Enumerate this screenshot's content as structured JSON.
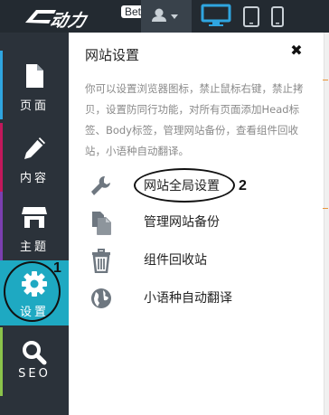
{
  "header": {
    "logo_text": "动力",
    "beta_badge": "Beta",
    "user_icon": "user-icon",
    "devices": [
      "desktop-icon",
      "tablet-icon",
      "phone-icon"
    ]
  },
  "sidebar": {
    "items": [
      {
        "label": "页面",
        "icon": "page-icon",
        "accent": "#2fa5e0"
      },
      {
        "label": "内容",
        "icon": "pencil-icon",
        "accent": "#c2185b"
      },
      {
        "label": "主题",
        "icon": "store-icon",
        "accent": "#7b3fb0"
      },
      {
        "label": "设置",
        "icon": "gear-icon",
        "accent": "#1ea9c2"
      },
      {
        "label": "SEO",
        "icon": "search-icon",
        "accent": "#8bc34a"
      }
    ]
  },
  "panel": {
    "title": "网站设置",
    "close_icon": "close-icon",
    "description": "你可以设置浏览器图标，禁止鼠标右键，禁止拷贝，设置防同行功能，对所有页面添加Head标签、Body标签，管理网站备份，查看组件回收站，小语种自动翻译。",
    "items": [
      {
        "label": "网站全局设置",
        "icon": "wrench-icon"
      },
      {
        "label": "管理网站备份",
        "icon": "backup-icon"
      },
      {
        "label": "组件回收站",
        "icon": "trash-icon"
      },
      {
        "label": "小语种自动翻译",
        "icon": "globe-icon"
      }
    ]
  },
  "annotations": {
    "marker_1": "1",
    "marker_2": "2"
  },
  "colors": {
    "topbar": "#232a31",
    "sidebar": "#2b323a",
    "active": "#1ea9c2",
    "device_active": "#2fa5e0"
  }
}
